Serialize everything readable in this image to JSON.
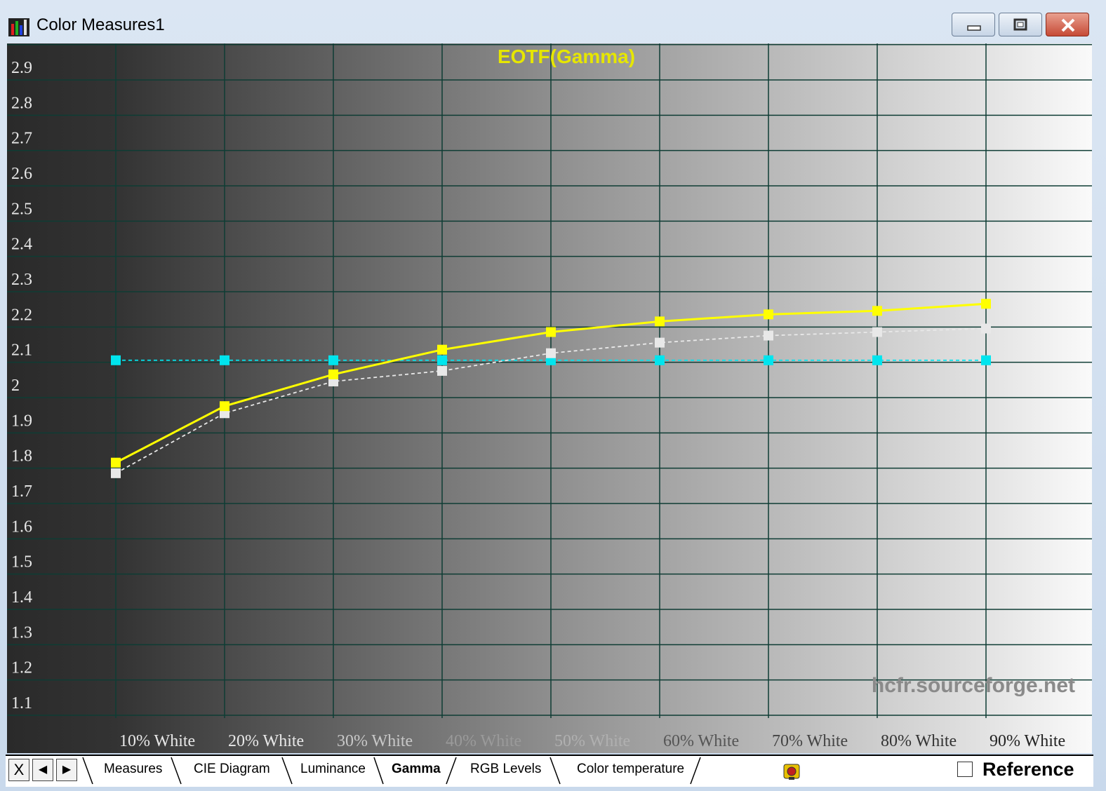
{
  "window": {
    "title": "Color Measures1",
    "minimize_icon": "minimize-icon",
    "maximize_icon": "restore-icon",
    "close_icon": "close-icon"
  },
  "chart_data": {
    "type": "line",
    "title": "EOTF(Gamma)",
    "categories": [
      "10% White",
      "20% White",
      "30% White",
      "40% White",
      "50% White",
      "60% White",
      "70% White",
      "80% White",
      "90% White"
    ],
    "series": [
      {
        "values": [
          1.78,
          1.94,
          2.03,
          2.1,
          2.15,
          2.18,
          2.2,
          2.21,
          2.23
        ],
        "color": "#ffff00",
        "style": "solid"
      },
      {
        "values": [
          1.75,
          1.92,
          2.01,
          2.04,
          2.09,
          2.12,
          2.14,
          2.15,
          2.16
        ],
        "color": "#e8e8e8",
        "style": "dashed"
      },
      {
        "values": [
          2.07,
          2.07,
          2.07,
          2.07,
          2.07,
          2.07,
          2.07,
          2.07,
          2.07
        ],
        "color": "#00e5ee",
        "style": "dashed"
      }
    ],
    "yticks": [
      "1.1",
      "1.2",
      "1.3",
      "1.4",
      "1.5",
      "1.6",
      "1.7",
      "1.8",
      "1.9",
      "2",
      "2.1",
      "2.2",
      "2.3",
      "2.4",
      "2.5",
      "2.6",
      "2.7",
      "2.8",
      "2.9"
    ],
    "ylim": [
      1.04,
      2.98
    ],
    "grid": true,
    "watermark": "hcfr.sourceforge.net",
    "colors": {
      "grid": "#0e3c34",
      "title": "#e6e600",
      "tick": "#e8e8e8",
      "watermark": "#8a8a8a"
    }
  },
  "tabs": {
    "nav": [
      "X",
      "◀",
      "▶"
    ],
    "items": [
      "Measures",
      "CIE Diagram",
      "Luminance",
      "Gamma",
      "RGB Levels",
      "Color temperature"
    ],
    "active": "Gamma",
    "reference_label": "Reference",
    "reference_checked": false,
    "device_icon": "sensor-icon"
  }
}
